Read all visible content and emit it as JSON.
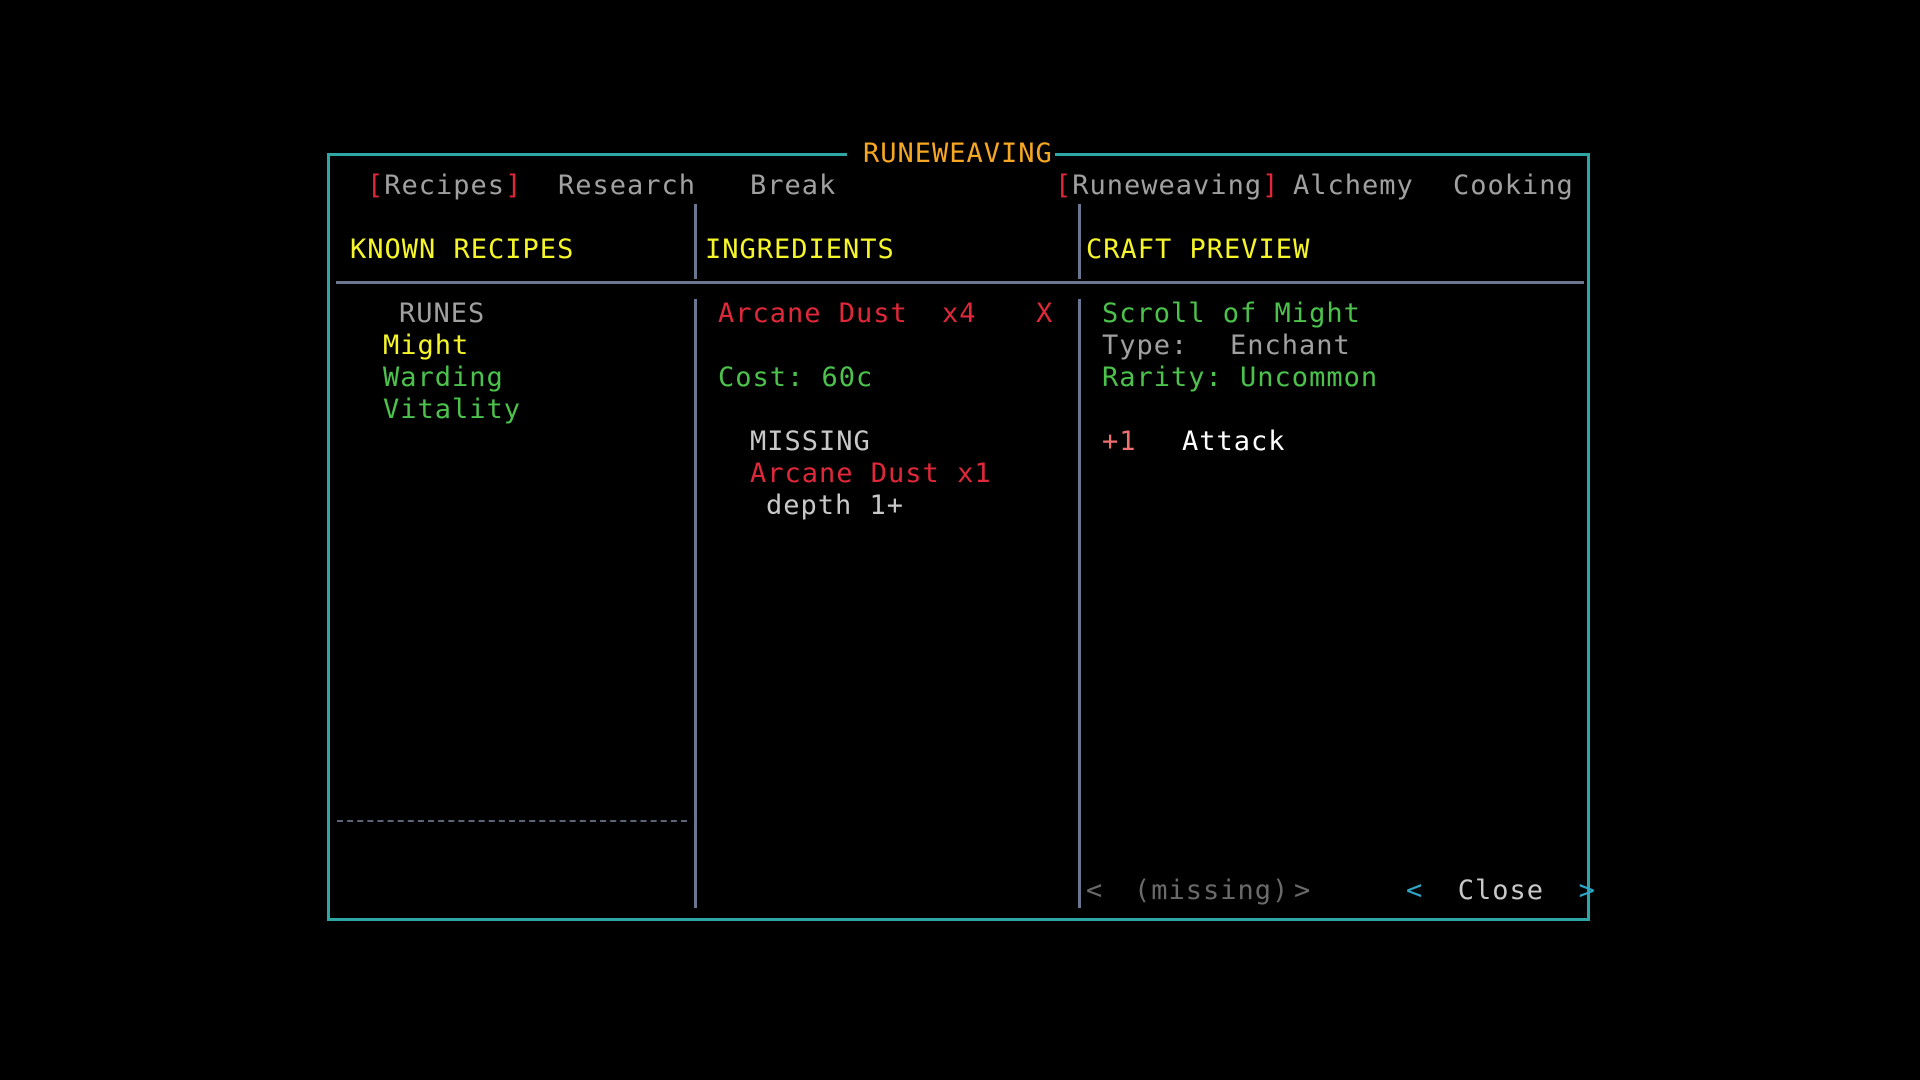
{
  "window": {
    "title": "RUNEWEAVING"
  },
  "tabs_left": [
    {
      "label": "Recipes",
      "active": true
    },
    {
      "label": "Research",
      "active": false
    },
    {
      "label": "Break",
      "active": false
    }
  ],
  "tabs_right": [
    {
      "label": "Runeweaving",
      "active": true
    },
    {
      "label": "Alchemy",
      "active": false
    },
    {
      "label": "Cooking",
      "active": false
    }
  ],
  "brackets": {
    "open": "[",
    "close": "]"
  },
  "columns": {
    "recipes_header": "KNOWN RECIPES",
    "ingredients_header": "INGREDIENTS",
    "preview_header": "CRAFT PREVIEW"
  },
  "recipes": {
    "category": "RUNES",
    "items": [
      {
        "label": "Might",
        "selected": true
      },
      {
        "label": "Warding",
        "selected": false
      },
      {
        "label": "Vitality",
        "selected": false
      }
    ]
  },
  "ingredients": {
    "items": [
      {
        "name": "Arcane Dust",
        "qty": "x4",
        "status": "X"
      }
    ],
    "cost": "Cost: 60c",
    "missing_header": "MISSING",
    "missing_items": [
      {
        "name": "Arcane Dust x1",
        "hint": "depth 1+"
      }
    ]
  },
  "preview": {
    "name": "Scroll of Might",
    "type_label": "Type:",
    "type_value": "Enchant",
    "rarity": "Rarity: Uncommon",
    "stat_value": "+1",
    "stat_name": "Attack"
  },
  "footer": {
    "nav_left": "<",
    "nav_status": "(missing)",
    "nav_right": ">",
    "close_left": "<",
    "close_label": "Close",
    "close_right": ">"
  },
  "colors": {
    "frame": "#2ea6a6",
    "title": "#f5a623",
    "header": "#f5f52a",
    "available": "#4cc24c",
    "missing": "#e0283a",
    "divider": "#6a7690"
  }
}
